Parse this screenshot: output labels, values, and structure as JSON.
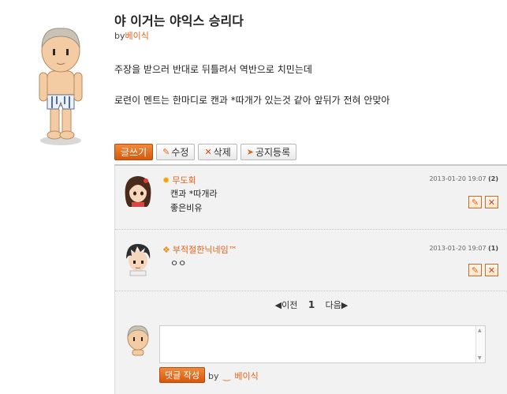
{
  "post": {
    "title": "야 이거는 야익스 승리다",
    "by_prefix": "by",
    "author": "베이식",
    "body": [
      "주장을 받으러 반대로 뒤틀려서 역반으로 치민는데",
      "로련이 멘트는 한마디로 캔과 *따개가 있는것 같아 앞뒤가 전혀 안맞아"
    ]
  },
  "actions": {
    "write": "글쓰기",
    "edit": "수정",
    "delete": "삭제",
    "notice": "공지등록"
  },
  "comments": [
    {
      "nick": "무도회",
      "date": "2013-01-20 19:07",
      "count": "(2)",
      "lines": [
        "캔과 *따개라",
        "좋은비유"
      ]
    },
    {
      "nick": "부적절한닉네임™",
      "date": "2013-01-20 19:07",
      "count": "(1)",
      "lines": [
        "ㅇㅇ"
      ]
    }
  ],
  "pager": {
    "prev": "◀이전",
    "current": "1",
    "next": "다음▶"
  },
  "reply": {
    "submit": "댓글 작성",
    "by_prefix": "by",
    "author": "베이식"
  },
  "colors": {
    "accent": "#e4621a",
    "panel": "#f2f2f2"
  }
}
